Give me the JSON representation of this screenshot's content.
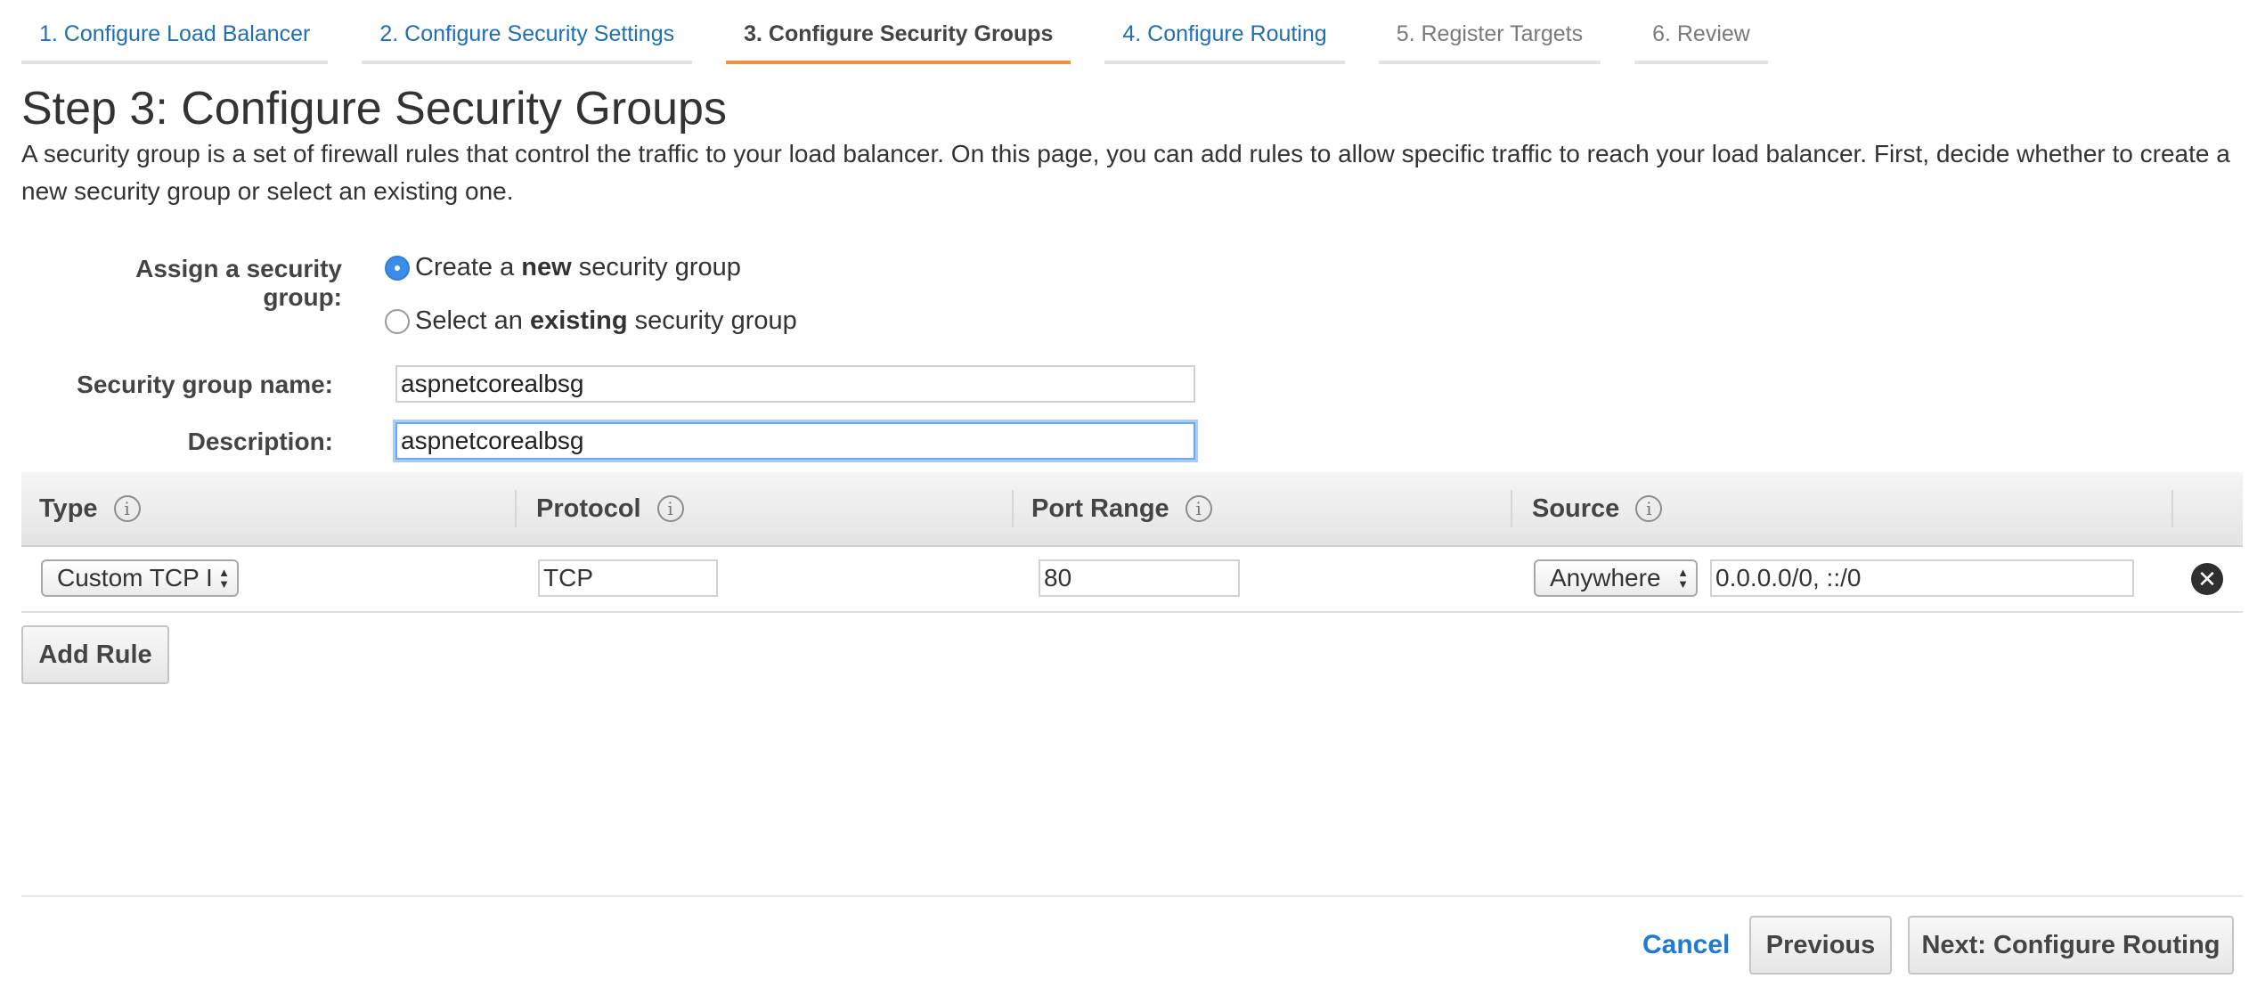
{
  "tabs": [
    {
      "label": "1. Configure Load Balancer",
      "state": "link"
    },
    {
      "label": "2. Configure Security Settings",
      "state": "link"
    },
    {
      "label": "3. Configure Security Groups",
      "state": "active"
    },
    {
      "label": "4. Configure Routing",
      "state": "link"
    },
    {
      "label": "5. Register Targets",
      "state": "disabled"
    },
    {
      "label": "6. Review",
      "state": "disabled"
    }
  ],
  "page": {
    "title": "Step 3: Configure Security Groups",
    "intro": "A security group is a set of firewall rules that control the traffic to your load balancer. On this page, you can add rules to allow specific traffic to reach your load balancer. First, decide whether to create a new security group or select an existing one."
  },
  "assign": {
    "label": "Assign a security group:",
    "option_new": {
      "prefix": "Create a ",
      "bold": "new",
      "suffix": " security group",
      "selected": true
    },
    "option_existing": {
      "prefix": "Select an ",
      "bold": "existing",
      "suffix": " security group",
      "selected": false
    }
  },
  "form": {
    "name_label": "Security group name:",
    "name_value": "aspnetcorealbsg",
    "description_label": "Description:",
    "description_value": "aspnetcorealbsg"
  },
  "rules": {
    "columns": [
      "Type",
      "Protocol",
      "Port Range",
      "Source"
    ],
    "info_glyph": "i",
    "rows": [
      {
        "type": "Custom TCP I",
        "protocol": "TCP",
        "port_range": "80",
        "source_select": "Anywhere",
        "source_value": "0.0.0.0/0, ::/0"
      }
    ],
    "add_rule_label": "Add Rule"
  },
  "icons": {
    "info": "info-icon",
    "remove": "remove-circle-icon",
    "select_arrows": "updown-arrows-icon"
  },
  "colors": {
    "active_tab_underline": "#f0923a",
    "link": "#1f7ad0",
    "radio_selected": "#3b8ee8",
    "focus_ring": "#6aa7f0"
  },
  "footer": {
    "cancel_label": "Cancel",
    "previous_label": "Previous",
    "next_label": "Next: Configure Routing"
  }
}
